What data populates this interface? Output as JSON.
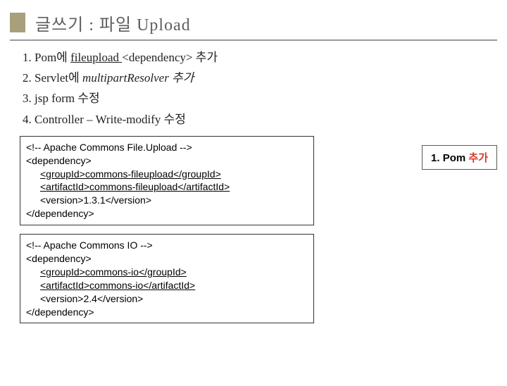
{
  "title": "글쓰기 : 파일 Upload",
  "steps": {
    "s1_prefix": "1. Pom에 ",
    "s1_underline": "fileupload ",
    "s1_rest": "<dependency> 추가",
    "s2_prefix": "2. Servlet에 ",
    "s2_italic": "multipartResolver 추가",
    "s3": "3. jsp  form 수정",
    "s4": "4. Controller – Write-modify 수정"
  },
  "box1": {
    "l1": "<!-- Apache Commons File.Upload -->",
    "l2": "<dependency>",
    "l3": "<groupId>commons-fileupload</groupId>",
    "l4": "<artifactId>commons-fileupload</artifactId>",
    "l5": "<version>1.3.1</version>",
    "l6": "</dependency>"
  },
  "box2": {
    "l1": "<!-- Apache Commons IO -->",
    "l2": "<dependency>",
    "l3": "<groupId>commons-io</groupId>",
    "l4": "<artifactId>commons-io</artifactId>",
    "l5": "<version>2.4</version>",
    "l6": "</dependency>"
  },
  "caption": {
    "label": "1. Pom ",
    "red": "추가"
  }
}
